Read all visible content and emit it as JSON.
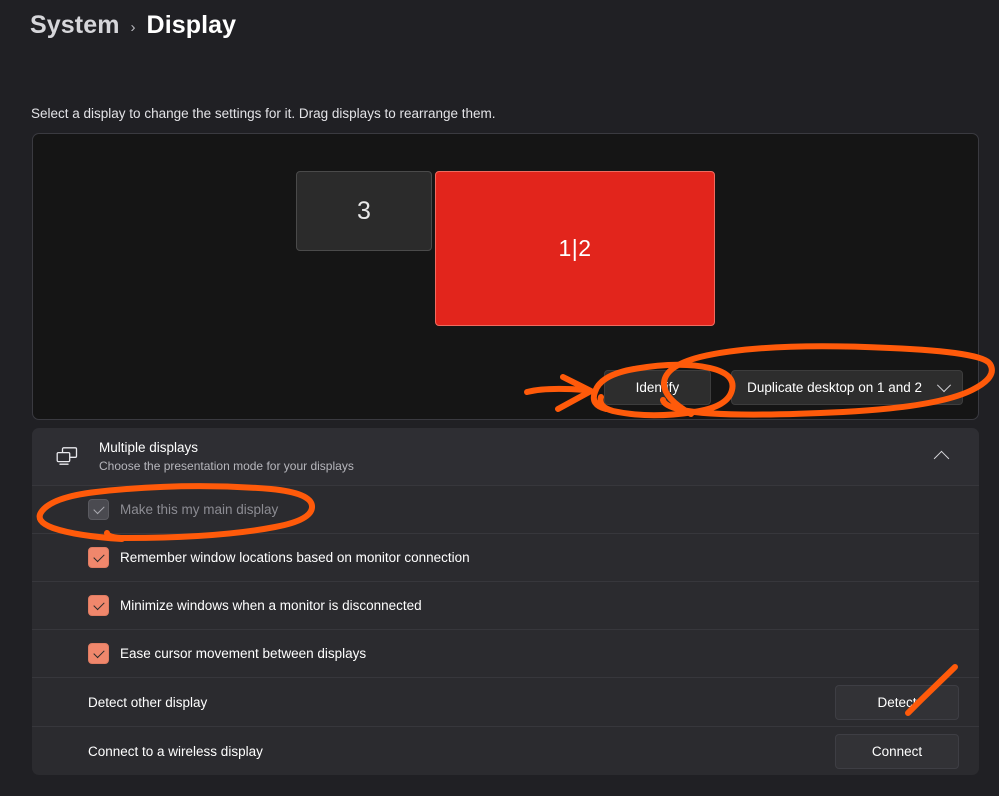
{
  "breadcrumb": {
    "parent": "System",
    "separator": "›",
    "current": "Display"
  },
  "caption": "Select a display to change the settings for it. Drag displays to rearrange them.",
  "preview": {
    "monitors": [
      {
        "label": "3",
        "state": "inactive"
      },
      {
        "label": "1|2",
        "state": "selected"
      }
    ],
    "identify_label": "Identify",
    "mode_value": "Duplicate desktop on 1 and 2",
    "chevron_icon": "chevron-down-icon"
  },
  "section": {
    "icon": "multiple-displays-icon",
    "title": "Multiple displays",
    "subtitle": "Choose the presentation mode for your displays",
    "collapse_icon": "chevron-up-icon"
  },
  "checkboxes": [
    {
      "label": "Make this my main display",
      "checked": true,
      "disabled": true
    },
    {
      "label": "Remember window locations based on monitor connection",
      "checked": true,
      "disabled": false
    },
    {
      "label": "Minimize windows when a monitor is disconnected",
      "checked": true,
      "disabled": false
    },
    {
      "label": "Ease cursor movement between displays",
      "checked": true,
      "disabled": false
    }
  ],
  "action_rows": [
    {
      "label": "Detect other display",
      "button": "Detect"
    },
    {
      "label": "Connect to a wireless display",
      "button": "Connect"
    }
  ],
  "colors": {
    "page_background": "#202024",
    "preview_background": "#151515",
    "row_background": "#2b2b2f",
    "section_background": "#2e2e33",
    "selected_display": "#e2251c",
    "inactive_display": "#2b2b2b",
    "checkbox_checked": "#f0876c",
    "annotation_ink": "#ff5a0a"
  },
  "annotations": {
    "ink_color": "#ff5a0a",
    "marks": [
      "arrow-to-identify",
      "ellipse-around-identify",
      "ellipse-around-mode-dropdown",
      "ellipse-around-main-display-checkbox",
      "check-on-detect-button"
    ]
  }
}
